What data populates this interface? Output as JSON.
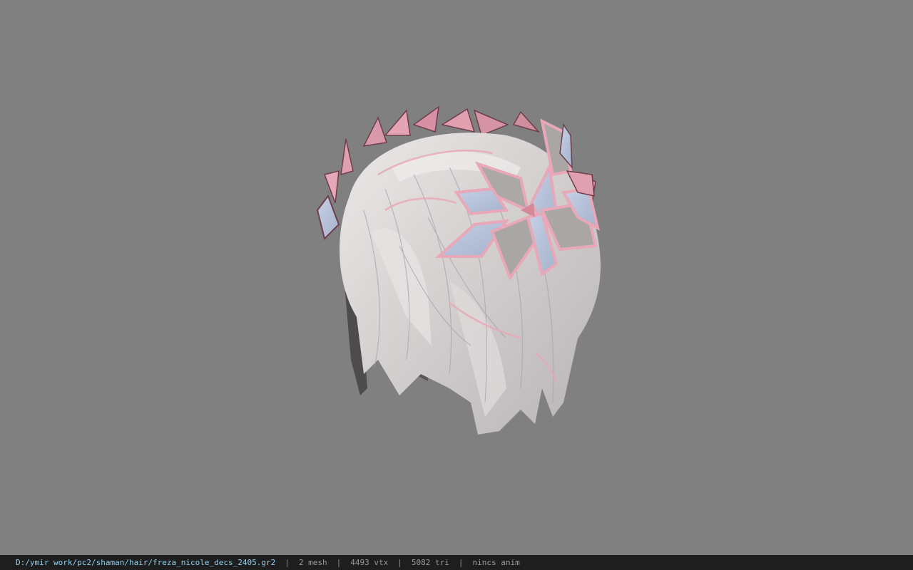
{
  "viewport": {
    "background": "#808080",
    "model": {
      "hair_color": "#d8d4d4",
      "hair_shadow": "#5a5758",
      "leaf_pink": "#e8a8b8",
      "leaf_edge": "#7a4a58",
      "leaf_blue": "#b8c4dc",
      "leaf_grey": "#aaa6a6"
    }
  },
  "statusbar": {
    "file_path": "D:/ymir work/pc2/shaman/hair/freza_nicole_decs_2405.gr2",
    "separator": "|",
    "mesh_count": "2 mesh",
    "vertex_count": "4493 vtx",
    "triangle_count": "5082 tri",
    "anim_status": "nincs anim",
    "path_color": "#8fd0ee",
    "background": "#1e1e1e"
  }
}
